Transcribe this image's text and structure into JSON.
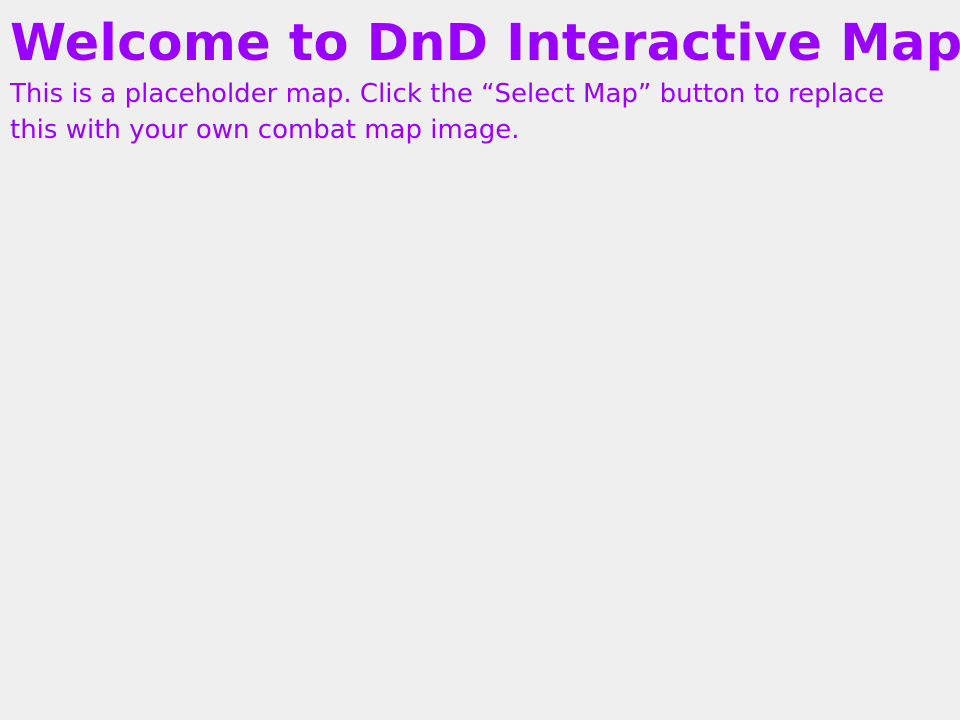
{
  "page": {
    "title": "Welcome to DnD Interactive Map!",
    "message": "This is a placeholder map. Click the “Select Map” button to replace this with your own combat map image."
  },
  "colors": {
    "background": "#efefef",
    "text_accent": "#9900ff"
  }
}
